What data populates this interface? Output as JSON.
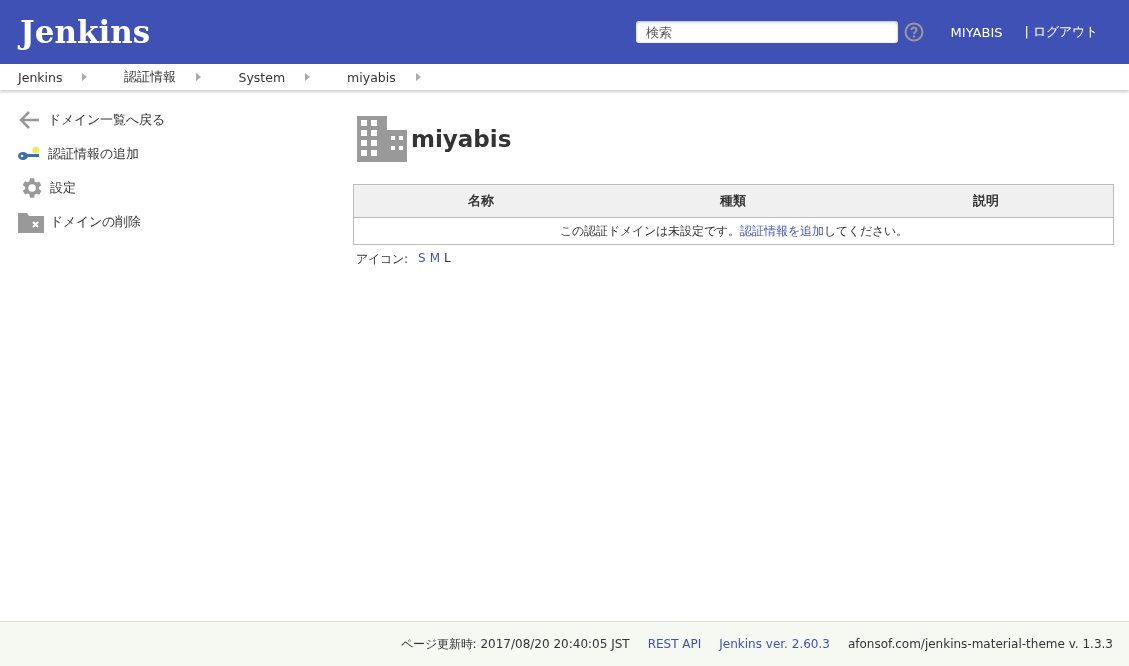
{
  "header": {
    "logo": "Jenkins",
    "search": {
      "placeholder": "検索"
    },
    "user": "MIYABIS",
    "logout": "| ログアウト"
  },
  "breadcrumbs": [
    "Jenkins",
    "認証情報",
    "System",
    "miyabis"
  ],
  "sidebar": {
    "items": [
      {
        "kind": "back",
        "label": "ドメイン一覧へ戻る"
      },
      {
        "kind": "key",
        "label": "認証情報の追加"
      },
      {
        "kind": "gear",
        "label": "設定"
      },
      {
        "kind": "delete",
        "label": "ドメインの削除"
      }
    ]
  },
  "main": {
    "title": "miyabis",
    "table": {
      "columns": [
        "名称",
        "種類",
        "説明"
      ],
      "empty_message": {
        "before": "この認証ドメインは未設定です。",
        "link": "認証情報を追加",
        "after": "してください。"
      }
    },
    "icon_size": {
      "label": "アイコン:",
      "sizes": [
        {
          "label": "S",
          "selected": false
        },
        {
          "label": "M",
          "selected": false
        },
        {
          "label": "L",
          "selected": true
        }
      ]
    }
  },
  "footer": {
    "updated": "ページ更新時: 2017/08/20 20:40:05 JST",
    "links": [
      "REST API",
      "Jenkins ver. 2.60.3"
    ],
    "theme": "afonsof.com/jenkins-material-theme v. 1.3.3"
  }
}
